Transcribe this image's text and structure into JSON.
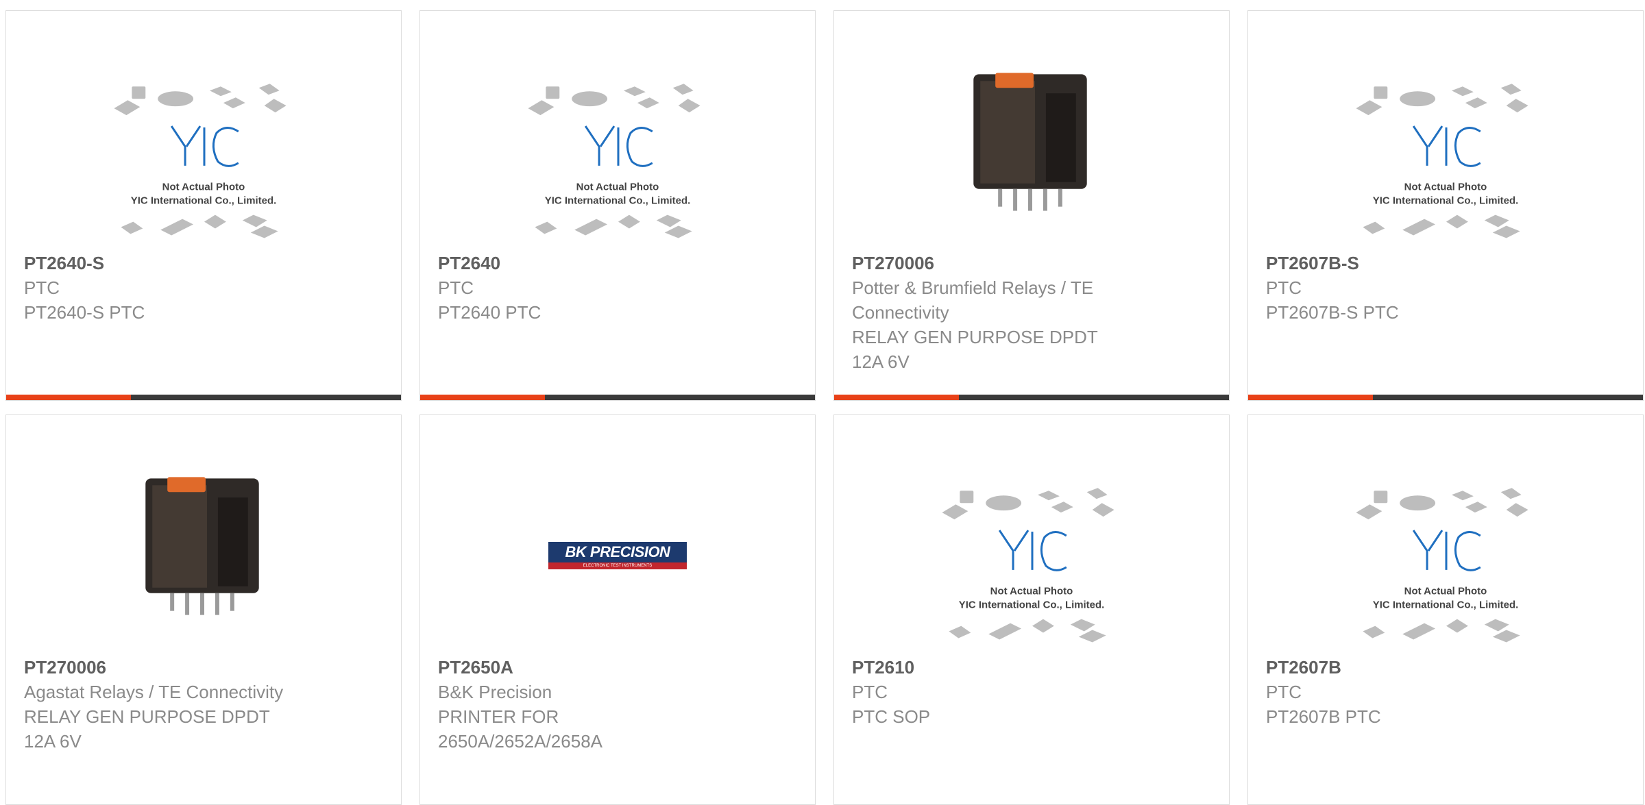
{
  "accent_color": "#e84118",
  "bar_color": "#3a3a3a",
  "placeholder": {
    "line1": "Not Actual Photo",
    "line2": "YIC International Co., Limited.",
    "logo": "YIC"
  },
  "brand_logo": {
    "text": "BK PRECISION",
    "tagline": "ELECTRONIC TEST INSTRUMENTS"
  },
  "products": [
    {
      "pn": "PT2640-S",
      "line1": "PTC",
      "line2": "PT2640-S PTC",
      "line3": "",
      "line4": "",
      "image": "placeholder"
    },
    {
      "pn": "PT2640",
      "line1": "PTC",
      "line2": "PT2640 PTC",
      "line3": "",
      "line4": "",
      "image": "placeholder"
    },
    {
      "pn": "PT270006",
      "line1": "Potter & Brumfield Relays / TE",
      "line2": "Connectivity",
      "line3": "RELAY GEN PURPOSE DPDT",
      "line4": "12A 6V",
      "image": "relay"
    },
    {
      "pn": "PT2607B-S",
      "line1": "PTC",
      "line2": "PT2607B-S PTC",
      "line3": "",
      "line4": "",
      "image": "placeholder"
    },
    {
      "pn": "PT270006",
      "line1": "Agastat Relays / TE Connectivity",
      "line2": "RELAY GEN PURPOSE DPDT",
      "line3": "12A 6V",
      "line4": "",
      "image": "relay"
    },
    {
      "pn": "PT2650A",
      "line1": "B&K Precision",
      "line2": "PRINTER FOR",
      "line3": "2650A/2652A/2658A",
      "line4": "",
      "image": "bk-logo"
    },
    {
      "pn": "PT2610",
      "line1": "PTC",
      "line2": "PTC SOP",
      "line3": "",
      "line4": "",
      "image": "placeholder"
    },
    {
      "pn": "PT2607B",
      "line1": "PTC",
      "line2": "PT2607B PTC",
      "line3": "",
      "line4": "",
      "image": "placeholder"
    }
  ]
}
